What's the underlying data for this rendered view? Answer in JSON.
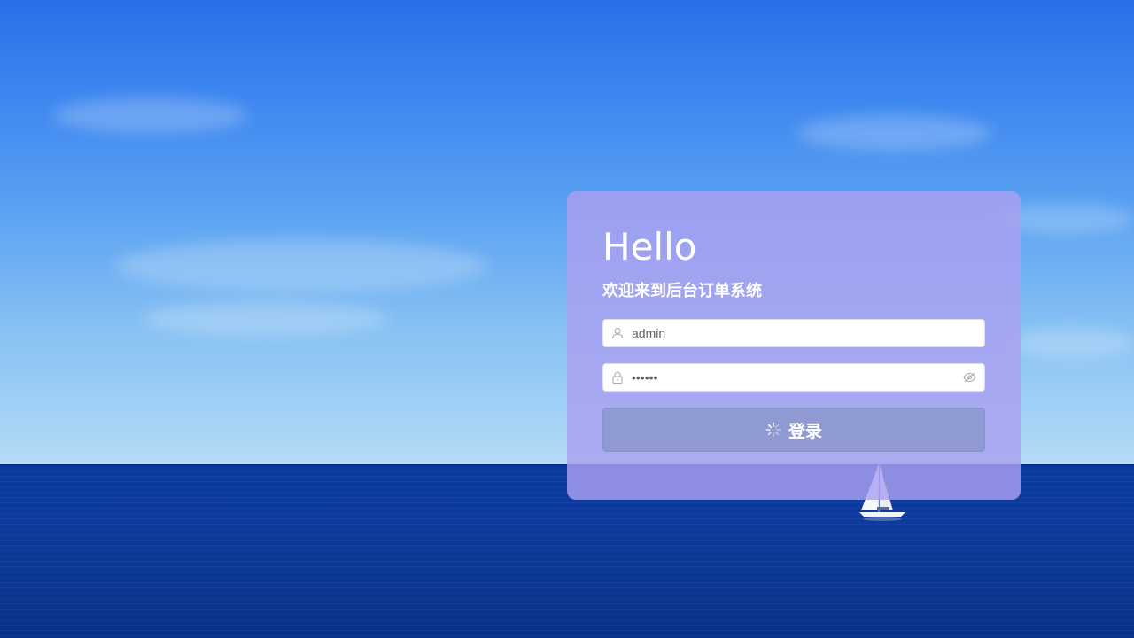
{
  "login": {
    "heading": "Hello",
    "subtitle": "欢迎来到后台订单系统",
    "username": {
      "value": "admin",
      "icon": "user-icon"
    },
    "password": {
      "value": "••••••",
      "icon": "lock-icon",
      "toggle_icon": "eye-off-icon"
    },
    "submit": {
      "label": "登录",
      "loading_icon": "loading-spinner-icon"
    }
  },
  "colors": {
    "card": "#a9a0f0",
    "button": "#8c98cd",
    "text": "#ffffff"
  }
}
